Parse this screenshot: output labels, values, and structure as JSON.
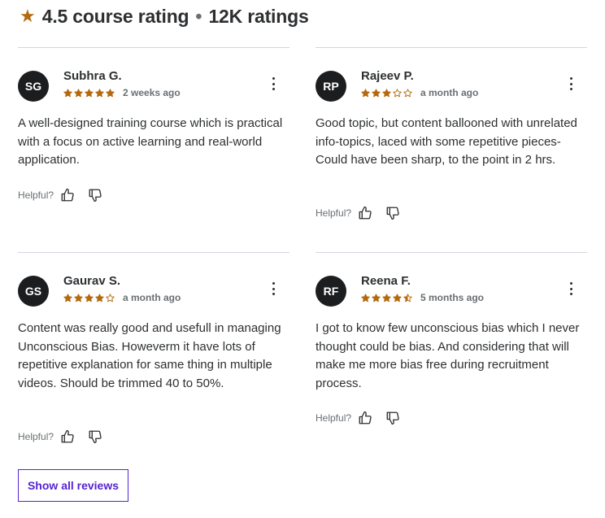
{
  "header": {
    "rating": "4.5 course rating",
    "separator": "•",
    "count": "12K ratings"
  },
  "helpful_label": "Helpful?",
  "reviews": [
    {
      "initials": "SG",
      "name": "Subhra G.",
      "stars": 5,
      "date": "2 weeks ago",
      "text": "A well-designed training course which is practical with a focus on active learning and real-world application."
    },
    {
      "initials": "RP",
      "name": "Rajeev P.",
      "stars": 3,
      "date": "a month ago",
      "text": "Good topic, but content ballooned with unrelated info-topics, laced with some repetitive pieces- Could have been sharp, to the point in 2 hrs."
    },
    {
      "initials": "GS",
      "name": "Gaurav S.",
      "stars": 4,
      "date": "a month ago",
      "text": "Content was really good and usefull in managing Unconscious Bias. Howeverm it have lots of repetitive explanation for same thing in multiple videos. Should be trimmed 40 to 50%."
    },
    {
      "initials": "RF",
      "name": "Reena F.",
      "stars": 4.5,
      "date": "5 months ago",
      "text": "I got to know few unconscious bias which I never thought could be bias. And considering that will make me more bias free during recruitment process."
    }
  ],
  "show_all_label": "Show all reviews",
  "colors": {
    "star": "#b4690e",
    "accent": "#5624d0",
    "text": "#2d2f31",
    "muted": "#6a6f73",
    "divider": "#d1d7dc",
    "avatar_bg": "#1c1d1f"
  },
  "icons": {
    "star": "star-icon",
    "more": "more-vertical-icon",
    "thumbs_up": "thumbs-up-icon",
    "thumbs_down": "thumbs-down-icon"
  }
}
